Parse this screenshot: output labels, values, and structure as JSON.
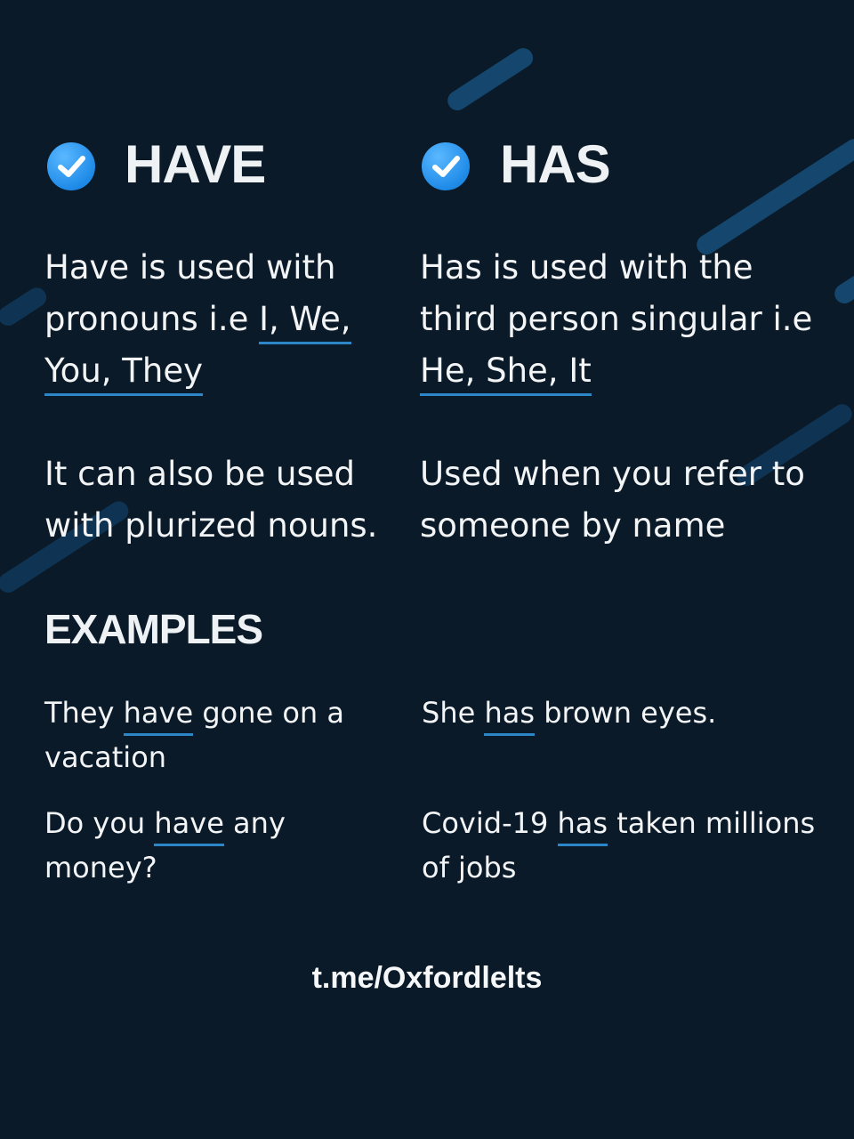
{
  "left": {
    "title": "HAVE",
    "para1_pre": "Have is used with pronouns i.e ",
    "para1_u1": "I, We,",
    "para1_u2": "You, They",
    "para2": "It can also be used with plurized nouns."
  },
  "right": {
    "title": "HAS",
    "para1_pre": "Has is used with the third person singular i.e ",
    "para1_u": "He, She, It",
    "para2": "Used when you refer to someone by name"
  },
  "examples": {
    "title": "EXAMPLES",
    "left": [
      {
        "pre": "They ",
        "key": "have",
        "post": " gone on a vacation"
      },
      {
        "pre": "Do you ",
        "key": "have",
        "post": " any money?"
      }
    ],
    "right": [
      {
        "pre": "She ",
        "key": "has",
        "post": " brown eyes."
      },
      {
        "pre": "Covid-19 ",
        "key": "has",
        "post": " taken millions of jobs"
      }
    ]
  },
  "footer": "t.me/Oxfordlelts",
  "colors": {
    "background": "#0a1a28",
    "accent": "#2d86c8",
    "check": "#1f8be8"
  },
  "icons": [
    "check-circle-icon"
  ]
}
